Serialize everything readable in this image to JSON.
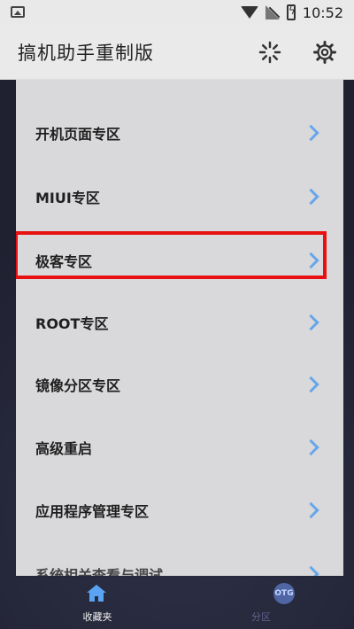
{
  "status_bar": {
    "time": "10:52",
    "icons": [
      "image-icon",
      "wifi-icon",
      "signal-off-icon",
      "battery-charging-icon"
    ]
  },
  "header": {
    "title": "搞机助手重制版",
    "actions": [
      "loading-spinner-icon",
      "settings-gear-icon"
    ]
  },
  "menu": {
    "items": [
      {
        "label": "开机页面专区"
      },
      {
        "label": "MIUI专区"
      },
      {
        "label": "极客专区",
        "highlighted": true
      },
      {
        "label": "ROOT专区"
      },
      {
        "label": "镜像分区专区"
      },
      {
        "label": "高级重启"
      },
      {
        "label": "应用程序管理专区"
      },
      {
        "label": "系统相关查看与调试"
      }
    ]
  },
  "tabs": [
    {
      "label": "收藏夹",
      "icon": "home-icon",
      "active": true
    },
    {
      "label": "分区",
      "icon": "otg-icon",
      "icon_text": "OTG",
      "active": false
    }
  ],
  "colors": {
    "chevron": "#67a7e9",
    "highlight_border": "#e81010",
    "panel": "#d9d9dc",
    "background": "#1f2030"
  }
}
